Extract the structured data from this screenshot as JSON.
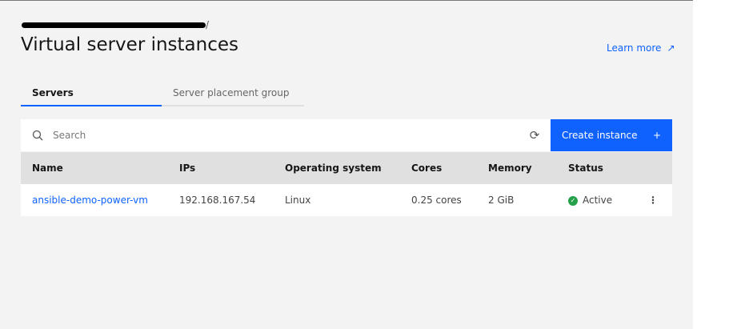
{
  "breadcrumb": {
    "separator": "/"
  },
  "page_title": "Virtual server instances",
  "learn_more": "Learn more",
  "tabs": [
    {
      "label": "Servers"
    },
    {
      "label": "Server placement group"
    }
  ],
  "search": {
    "placeholder": "Search"
  },
  "create_button": {
    "label": "Create instance",
    "icon": "+"
  },
  "table": {
    "headers": [
      "Name",
      "IPs",
      "Operating system",
      "Cores",
      "Memory",
      "Status"
    ],
    "rows": [
      {
        "name": "ansible-demo-power-vm",
        "ip": "192.168.167.54",
        "os": "Linux",
        "cores": "0.25 cores",
        "memory": "2 GiB",
        "status": "Active"
      }
    ]
  },
  "colors": {
    "accent": "#0f62fe",
    "success": "#24a148"
  }
}
